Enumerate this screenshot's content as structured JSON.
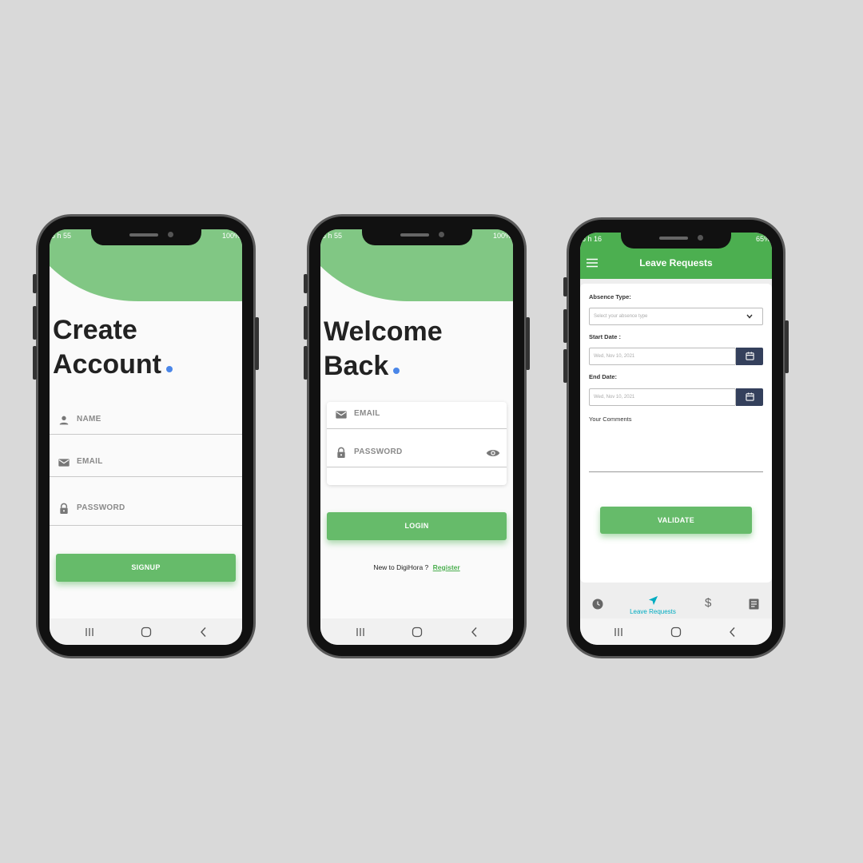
{
  "signup_screen": {
    "status_left": "6 h 55",
    "status_right": "100%",
    "title_line1": "Create",
    "title_line2": "Account",
    "fields": [
      {
        "icon": "person-icon",
        "label": "NAME"
      },
      {
        "icon": "mail-icon",
        "label": "EMAIL"
      },
      {
        "icon": "lock-icon",
        "label": "PASSWORD"
      }
    ],
    "button_label": "SIGNUP"
  },
  "login_screen": {
    "status_left": "6 h 55",
    "status_right": "100%",
    "title_line1": "Welcome",
    "title_line2": "Back",
    "fields": [
      {
        "icon": "mail-icon",
        "label": "EMAIL"
      },
      {
        "icon": "lock-icon",
        "label": "PASSWORD",
        "trailing_icon": "eye-icon"
      }
    ],
    "button_label": "LOGIN",
    "register_prompt": "New to DigiHora ?",
    "register_link": "Register"
  },
  "leave_screen": {
    "status_left": "6 h 16",
    "status_right": "65%",
    "header_title": "Leave Requests",
    "absence_label": "Absence Type:",
    "absence_placeholder": "Select your absence type",
    "start_label": "Start Date :",
    "start_value": "Wed, Nov 10, 2021",
    "end_label": "End Date:",
    "end_value": "Wed, Nov 10, 2021",
    "comments_label": "Your Comments",
    "button_label": "VALIDATE",
    "tabs": [
      {
        "icon": "clock-icon",
        "label": ""
      },
      {
        "icon": "send-icon",
        "label": "Leave Requests",
        "active": true
      },
      {
        "icon": "dollar-icon",
        "label": "$"
      },
      {
        "icon": "document-icon",
        "label": ""
      }
    ]
  },
  "colors": {
    "green": "#66bb6a",
    "header_green": "#4caf50",
    "curve_green": "#81c784",
    "accent_blue": "#4a86e8",
    "navy": "#34405c",
    "teal": "#00acc1"
  }
}
